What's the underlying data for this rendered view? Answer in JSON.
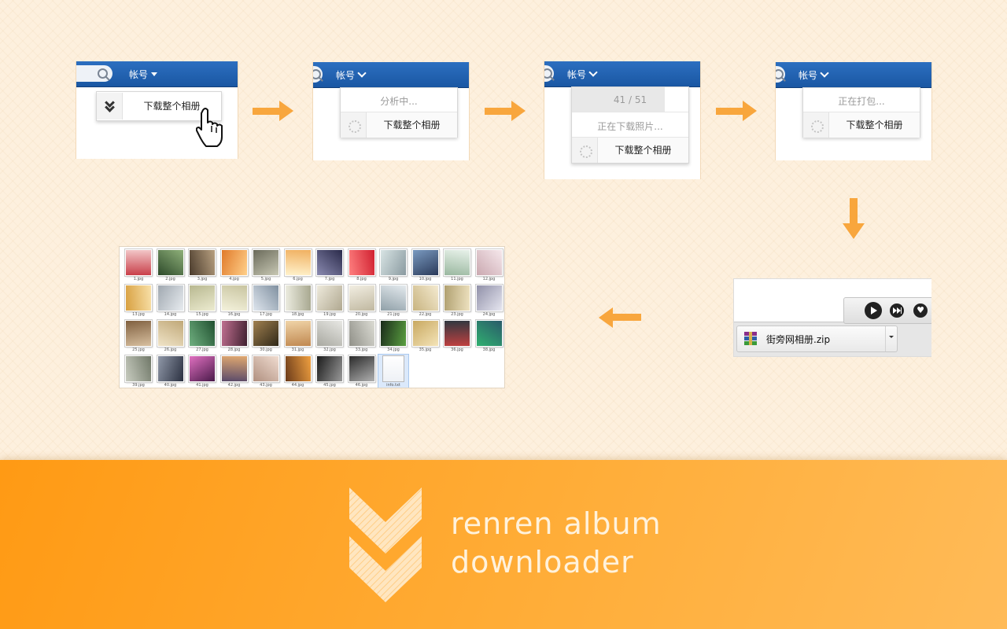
{
  "colors": {
    "accent_orange": "#f8a63d",
    "nav_blue": "#1f5fad",
    "footer_orange": "#ff9a14"
  },
  "steps": [
    {
      "account_label": "帐号",
      "status_text": "",
      "download_label": "下载整个相册",
      "icon": "double-chevron-down-icon",
      "cursor": "hand-pointer-icon"
    },
    {
      "account_label": "帐号",
      "status_text": "分析中...",
      "download_label": "下载整个相册",
      "icon": "loading-spinner-icon"
    },
    {
      "account_label": "帐号",
      "progress_text": "41 / 51",
      "progress_fraction": 0.8,
      "status_text": "正在下载照片...",
      "download_label": "下载整个相册",
      "icon": "loading-spinner-icon"
    },
    {
      "account_label": "帐号",
      "status_text": "正在打包...",
      "download_label": "下载整个相册",
      "icon": "loading-spinner-icon"
    }
  ],
  "download_bar": {
    "filename": "街旁网相册.zip",
    "file_icon": "winrar-archive-icon",
    "controls": [
      "play-icon",
      "skip-forward-icon",
      "heart-icon"
    ]
  },
  "file_grid": {
    "files": [
      "1.jpg",
      "2.jpg",
      "3.jpg",
      "4.jpg",
      "5.jpg",
      "6.jpg",
      "7.jpg",
      "8.jpg",
      "9.jpg",
      "10.jpg",
      "11.jpg",
      "12.jpg",
      "13.jpg",
      "14.jpg",
      "15.jpg",
      "16.jpg",
      "17.jpg",
      "18.jpg",
      "19.jpg",
      "20.jpg",
      "21.jpg",
      "22.jpg",
      "23.jpg",
      "24.jpg",
      "25.jpg",
      "26.jpg",
      "27.jpg",
      "28.jpg",
      "30.jpg",
      "31.jpg",
      "32.jpg",
      "33.jpg",
      "34.jpg",
      "35.jpg",
      "36.jpg",
      "38.jpg",
      "39.jpg",
      "40.jpg",
      "41.jpg",
      "42.jpg",
      "43.jpg",
      "44.jpg",
      "45.jpg",
      "46.jpg",
      "info.txt"
    ],
    "selected": "info.txt"
  },
  "brand": {
    "line1": "renren album",
    "line2": "downloader",
    "logo": "double-chevron-logo-icon"
  }
}
